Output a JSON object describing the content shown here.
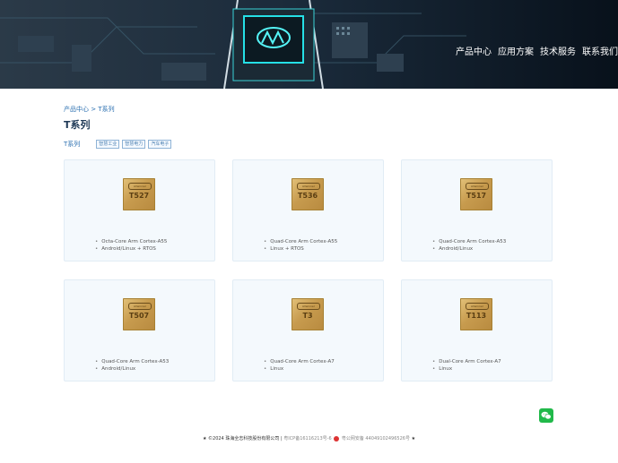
{
  "nav": [
    "产品中心",
    "应用方案",
    "技术服务",
    "联系我们"
  ],
  "breadcrumb": {
    "root": "产品中心",
    "sep": ">",
    "current": "T系列"
  },
  "page_title": "T系列",
  "filter": {
    "label": "T系列",
    "tags": [
      "智慧工业",
      "智慧电力",
      "汽车电子"
    ]
  },
  "products": [
    {
      "model": "T527",
      "specs": [
        "Octa-Core Arm Cortex-A55",
        "Android/Linux + RTOS"
      ]
    },
    {
      "model": "T536",
      "specs": [
        "Quad-Core Arm Cortex-A55",
        "Linux + RTOS"
      ]
    },
    {
      "model": "T517",
      "specs": [
        "Quad-Core Arm Cortex-A53",
        "Android/Linux"
      ]
    },
    {
      "model": "T507",
      "specs": [
        "Quad-Core Arm Cortex-A53",
        "Android/Linux"
      ]
    },
    {
      "model": "T3",
      "specs": [
        "Quad-Core Arm Cortex-A7",
        "Linux"
      ]
    },
    {
      "model": "T113",
      "specs": [
        "Dual-Core Arm Cortex-A7",
        "Linux"
      ]
    }
  ],
  "chip_brand": "Allwinner",
  "footer": {
    "star": "★",
    "copyright": "©2024 珠海全志科技股份有限公司",
    "divider": "|",
    "icp": "粤ICP备16116213号-6",
    "police": "粤公网安备 44049102496526号"
  },
  "icons": {
    "wechat": "wechat-icon",
    "police": "police-badge-icon"
  },
  "colors": {
    "accent": "#2a6fb0",
    "title": "#1f3a57",
    "card_bg": "#f4f9fd",
    "wechat": "#21b94a"
  }
}
